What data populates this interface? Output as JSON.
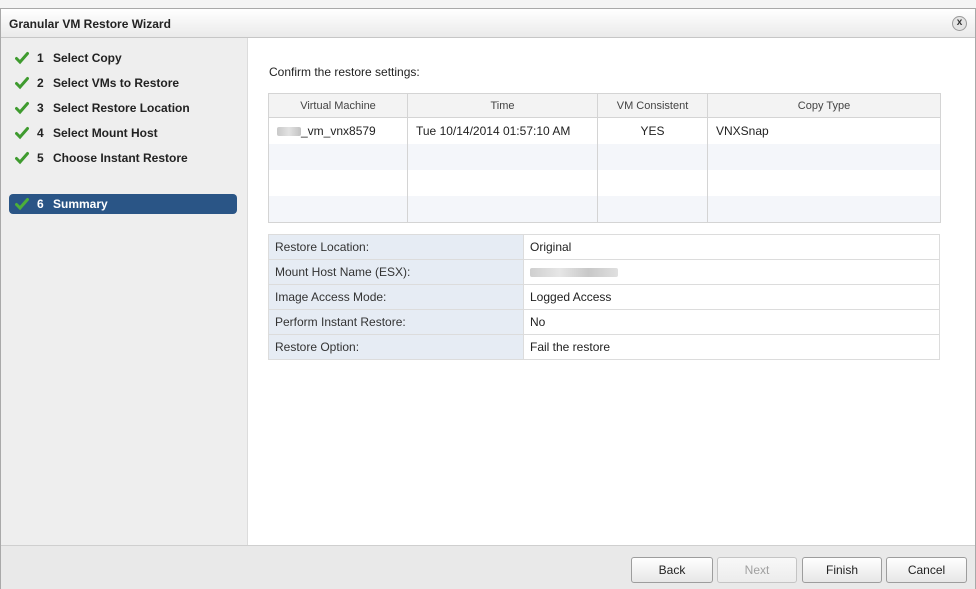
{
  "window": {
    "title": "Granular VM Restore Wizard",
    "close_glyph": "x"
  },
  "sidebar": {
    "steps": [
      {
        "number": "1",
        "label": "Select Copy",
        "state": "done"
      },
      {
        "number": "2",
        "label": "Select VMs to Restore",
        "state": "done"
      },
      {
        "number": "3",
        "label": "Select Restore Location",
        "state": "done"
      },
      {
        "number": "4",
        "label": "Select Mount Host",
        "state": "done"
      },
      {
        "number": "5",
        "label": "Choose Instant Restore",
        "state": "done"
      },
      {
        "number": "6",
        "label": "Summary",
        "state": "active"
      }
    ],
    "check_color": "#3f9b2f",
    "active_color": "#2a5586"
  },
  "main": {
    "heading": "Confirm the restore settings:",
    "copy_table": {
      "columns": [
        "Virtual Machine",
        "Time",
        "VM Consistent",
        "Copy Type"
      ],
      "rows": [
        {
          "vm": "_vm_vnx8579",
          "time": "Tue 10/14/2014 01:57:10 AM",
          "consistent": "YES",
          "copy_type": "VNXSnap"
        }
      ]
    },
    "settings": [
      {
        "label": "Restore Location:",
        "value": "Original"
      },
      {
        "label": "Mount Host Name (ESX):",
        "value": ""
      },
      {
        "label": "Image Access Mode:",
        "value": "Logged Access"
      },
      {
        "label": "Perform Instant Restore:",
        "value": "No"
      },
      {
        "label": "Restore Option:",
        "value": "Fail the restore"
      }
    ]
  },
  "footer": {
    "back": "Back",
    "next": "Next",
    "finish": "Finish",
    "cancel": "Cancel"
  }
}
